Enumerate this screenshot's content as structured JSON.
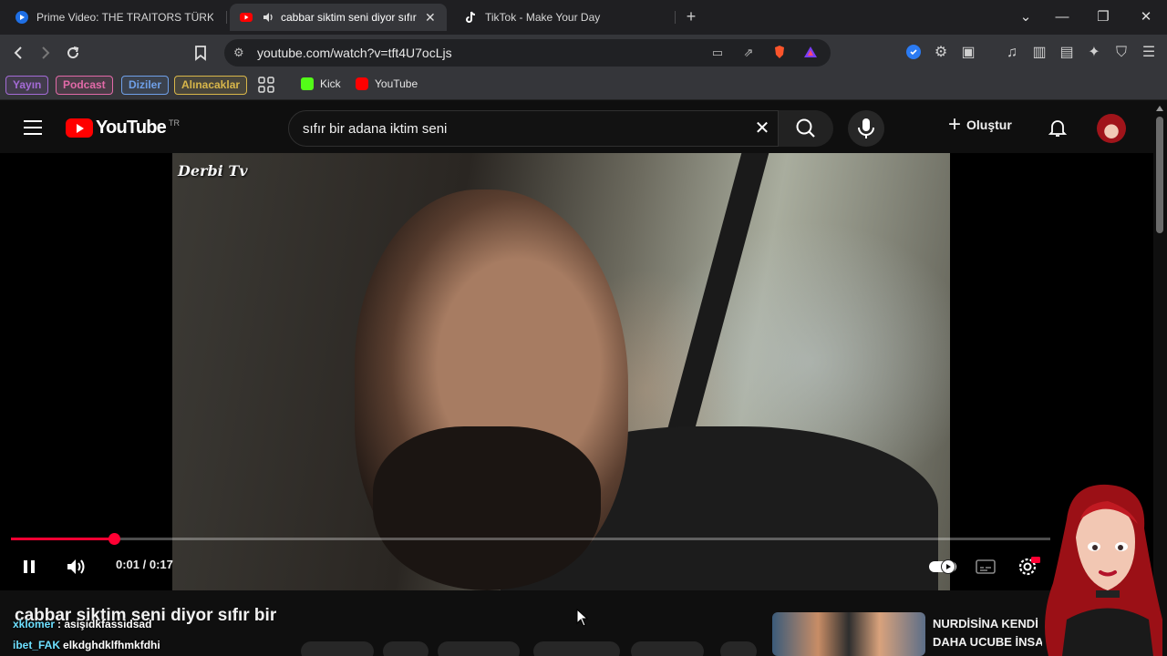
{
  "browser": {
    "tabs": [
      {
        "title": "Prime Video: THE TRAITORS TÜRKİYE",
        "icon": "prime-video-icon",
        "active": false
      },
      {
        "title": "cabbar siktim seni diyor sıfır bir",
        "icon": "youtube-icon",
        "active": true
      },
      {
        "title": "TikTok - Make Your Day",
        "icon": "tiktok-icon",
        "active": false
      }
    ],
    "url": "youtube.com/watch?v=tft4U7ocLjs",
    "bookmarks": {
      "chips": [
        {
          "label": "Yayın",
          "color": "#a46bd6"
        },
        {
          "label": "Podcast",
          "color": "#e26aa8"
        },
        {
          "label": "Diziler",
          "color": "#6fa0e8"
        },
        {
          "label": "Alınacaklar",
          "color": "#d8b64a"
        }
      ],
      "links": [
        {
          "label": "Kick",
          "color": "#53fc18"
        },
        {
          "label": "YouTube",
          "color": "#ff0000"
        }
      ]
    }
  },
  "youtube": {
    "logo_text": "YouTube",
    "country_code": "TR",
    "search_query": "sıfır bir adana iktim seni",
    "create_label": "Oluştur"
  },
  "player": {
    "watermark": "Derbi Tv",
    "current_time": "0:01",
    "duration": "0:17",
    "time_display": "0:01 / 0:17",
    "progress": 0.099,
    "quality_badge": "HD"
  },
  "video": {
    "title": "cabbar siktim seni diyor sıfır bir"
  },
  "chat": [
    {
      "user": "xklomer",
      "message": ": asişidkfassidsad"
    },
    {
      "user": "ibet_FAK",
      "message": "elkdghdklfhmkfdhi"
    }
  ],
  "recommendation": {
    "title_line1": "NURDİSİNA KENDİ",
    "title_line2": "DAHA UCUBE İNSA"
  },
  "colors": {
    "accent": "#ff0033",
    "youtube_red": "#ff0000"
  }
}
